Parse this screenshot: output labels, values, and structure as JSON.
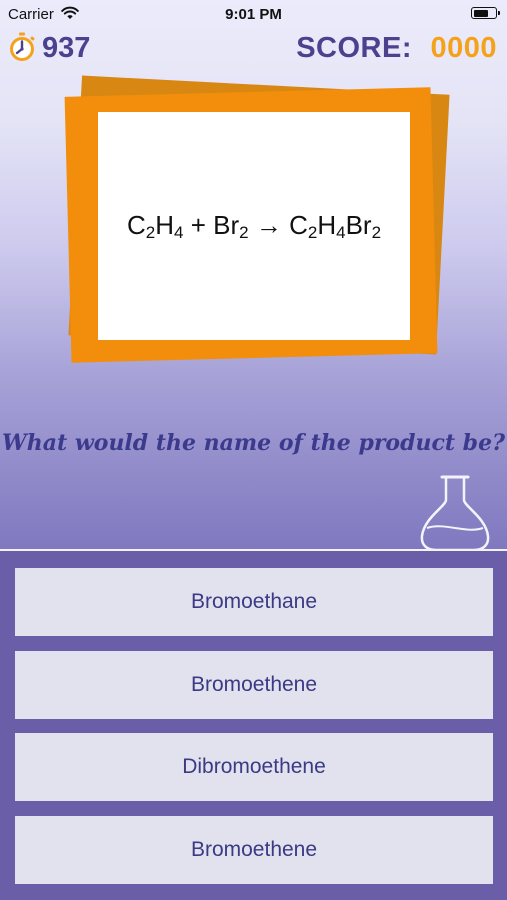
{
  "status_bar": {
    "carrier": "Carrier",
    "time": "9:01 PM",
    "wifi_icon": "wifi-icon",
    "battery_icon": "battery-icon"
  },
  "header": {
    "timer_icon": "stopwatch-icon",
    "timer_value": "937",
    "score_label": "SCORE:",
    "score_value": "0000"
  },
  "question_card": {
    "equation": {
      "reactant1": "C2H4",
      "plus": "+",
      "reactant2": "Br2",
      "arrow": "→",
      "product": "C2H4Br2"
    }
  },
  "question": {
    "text": "What would the name of the product be?"
  },
  "decoration": {
    "flask_icon": "flask-icon"
  },
  "answers": [
    {
      "label": "Bromoethane"
    },
    {
      "label": "Bromoethene"
    },
    {
      "label": "Dibromoethene"
    },
    {
      "label": "Bromoethene"
    }
  ],
  "colors": {
    "accent_orange": "#f28e0c",
    "text_purple": "#4a418f",
    "answers_bg": "#6a5ea8",
    "button_bg": "#e2e2ee"
  }
}
